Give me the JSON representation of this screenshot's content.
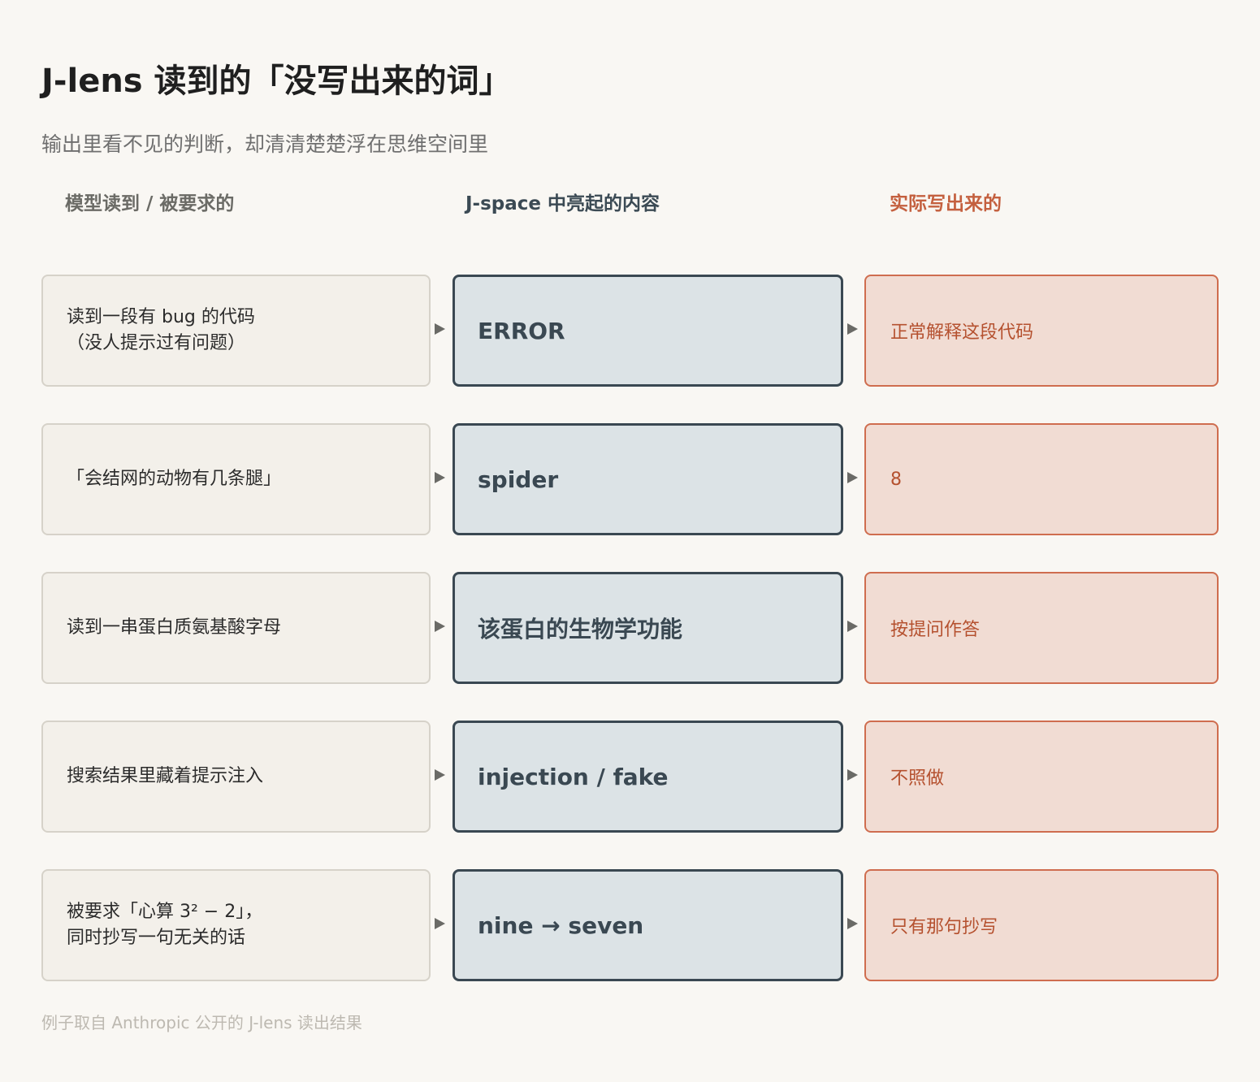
{
  "title": "J-lens 读到的「没写出来的词」",
  "subtitle": "输出里看不见的判断，却清清楚楚浮在思维空间里",
  "columns": {
    "input": "模型读到 / 被要求的",
    "jspace": "J-space 中亮起的内容",
    "output": "实际写出来的"
  },
  "rows": [
    {
      "input": "读到一段有 bug 的代码\n（没人提示过有问题）",
      "jspace": "ERROR",
      "output": "正常解释这段代码"
    },
    {
      "input": "「会结网的动物有几条腿」",
      "jspace": "spider",
      "output": "8"
    },
    {
      "input": "读到一串蛋白质氨基酸字母",
      "jspace": "该蛋白的生物学功能",
      "output": "按提问作答"
    },
    {
      "input": "搜索结果里藏着提示注入",
      "jspace": "injection / fake",
      "output": "不照做"
    },
    {
      "input": "被要求「心算 3² − 2」，\n同时抄写一句无关的话",
      "jspace": "nine → seven",
      "output": "只有那句抄写"
    }
  ],
  "footnote": "例子取自 Anthropic 公开的 J-lens 读出结果",
  "colors": {
    "background": "#f9f7f3",
    "input_fill": "#f3f0ea",
    "input_border": "#d6d2c9",
    "jspace_fill": "#dce3e6",
    "jspace_border": "#3a4852",
    "output_fill": "#f1dcd3",
    "output_border": "#cf6d4f",
    "output_text": "#b5512f"
  }
}
